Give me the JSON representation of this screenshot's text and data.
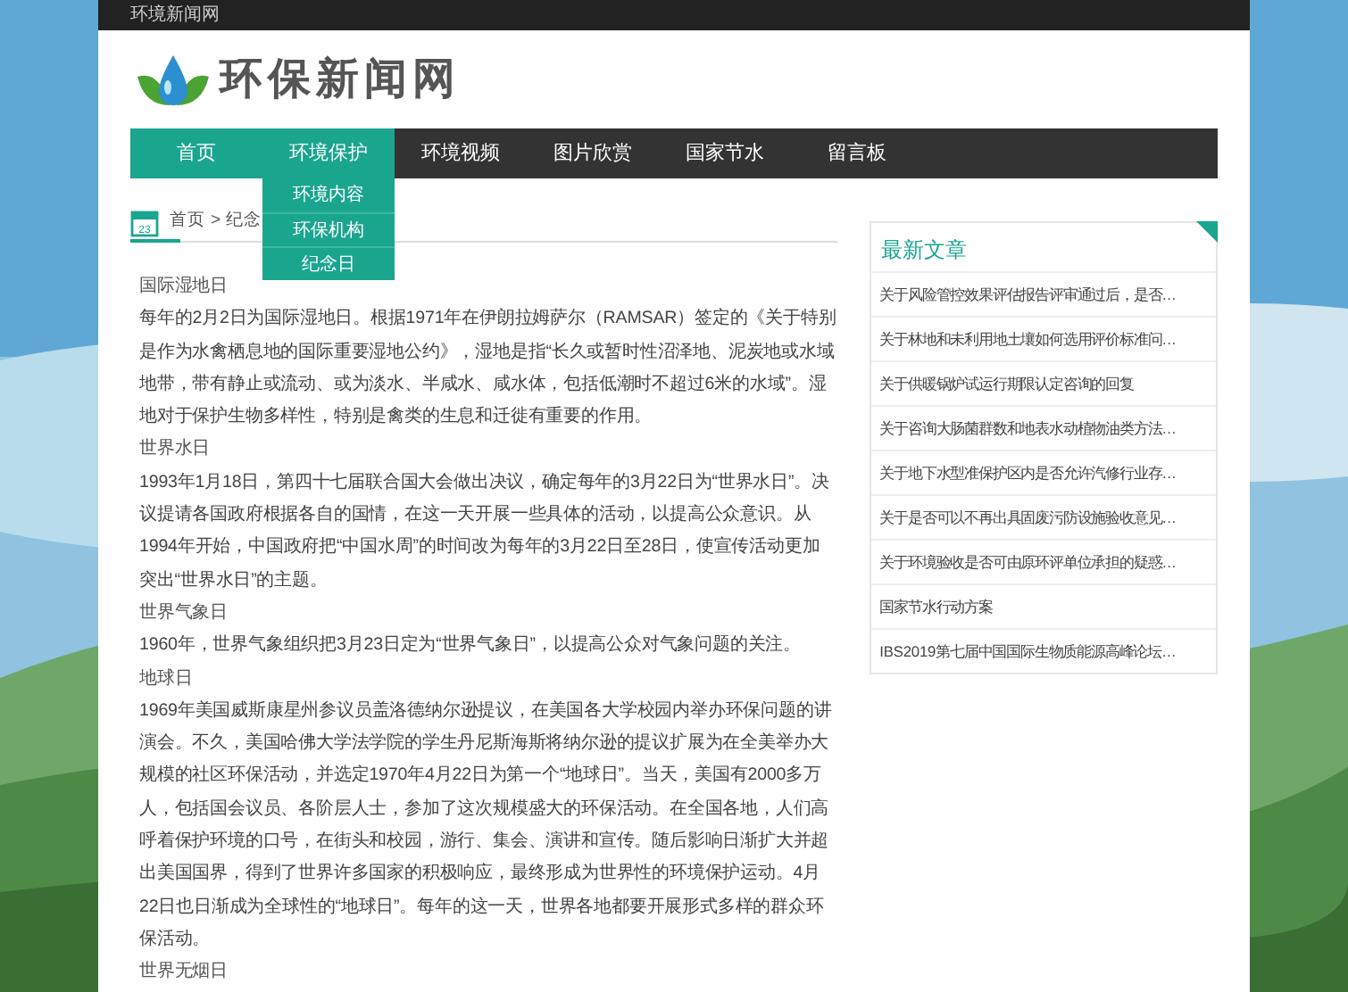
{
  "top_bar": {
    "site_name": "环境新闻网"
  },
  "logo": {
    "title": "环保新闻网"
  },
  "nav": [
    {
      "label": "首页",
      "selected": true
    },
    {
      "label": "环境保护",
      "selected": true,
      "expanded": true,
      "submenu": [
        "环境内容",
        "环保机构",
        "纪念日"
      ]
    },
    {
      "label": "环境视频",
      "selected": false
    },
    {
      "label": "图片欣赏",
      "selected": false
    },
    {
      "label": "国家节水",
      "selected": false
    },
    {
      "label": "留言板",
      "selected": false
    }
  ],
  "breadcrumb": {
    "icon_text": "23",
    "items": [
      "首页",
      "纪念"
    ],
    "separator": ">"
  },
  "article": [
    {
      "kind": "heading",
      "text": "国际湿地日"
    },
    {
      "kind": "paragraph",
      "text": "每年的2月2日为国际湿地日。根据1971年在伊朗拉姆萨尔（RAMSAR）签定的《关于特别是作为水禽栖息地的国际重要湿地公约》，湿地是指“长久或暂时性沼泽地、泥炭地或水域地带，带有静止或流动、或为淡水、半咸水、咸水体，包括低潮时不超过6米的水域”。湿地对于保护生物多样性，特别是禽类的生息和迁徙有重要的作用。"
    },
    {
      "kind": "heading",
      "text": "世界水日"
    },
    {
      "kind": "paragraph",
      "text": "1993年1月18日，第四十七届联合国大会做出决议，确定每年的3月22日为“世界水日”。决议提请各国政府根据各自的国情，在这一天开展一些具体的活动，以提高公众意识。从1994年开始，中国政府把“中国水周”的时间改为每年的3月22日至28日，使宣传活动更加突出“世界水日”的主题。"
    },
    {
      "kind": "heading",
      "text": "世界气象日"
    },
    {
      "kind": "paragraph",
      "text": "1960年，世界气象组织把3月23日定为“世界气象日”，以提高公众对气象问题的关注。"
    },
    {
      "kind": "heading",
      "text": "地球日"
    },
    {
      "kind": "paragraph",
      "text": "1969年美国威斯康星州参议员盖洛德纳尔逊提议，在美国各大学校园内举办环保问题的讲演会。不久，美国哈佛大学法学院的学生丹尼斯海斯将纳尔逊的提议扩展为在全美举办大规模的社区环保活动，并选定1970年4月22日为第一个“地球日”。当天，美国有2000多万人，包括国会议员、各阶层人士，参加了这次规模盛大的环保活动。在全国各地，人们高呼着保护环境的口号，在街头和校园，游行、集会、演讲和宣传。随后影响日渐扩大并超出美国国界，得到了世界许多国家的积极响应，最终形成为世界性的环境保护运动。4月22日也日渐成为全球性的“地球日”。每年的这一天，世界各地都要开展形式多样的群众环保活动。"
    },
    {
      "kind": "heading",
      "text": "世界无烟日"
    }
  ],
  "sidebar": {
    "title": "最新文章",
    "items": [
      "关于风险管控效果评估报告评审通过后，是否…",
      "关于林地和未利用地土壤如何选用评价标准问…",
      "关于供暖锅炉试运行期限认定咨询的回复",
      "关于咨询大肠菌群数和地表水动植物油类方法…",
      "关于地下水型准保护区内是否允许汽修行业存…",
      "关于是否可以不再出具固废污防设施验收意见…",
      "关于环境验收是否可由原环评单位承担的疑惑…",
      "国家节水行动方案",
      "IBS2019第七届中国国际生物质能源高峰论坛…"
    ]
  }
}
